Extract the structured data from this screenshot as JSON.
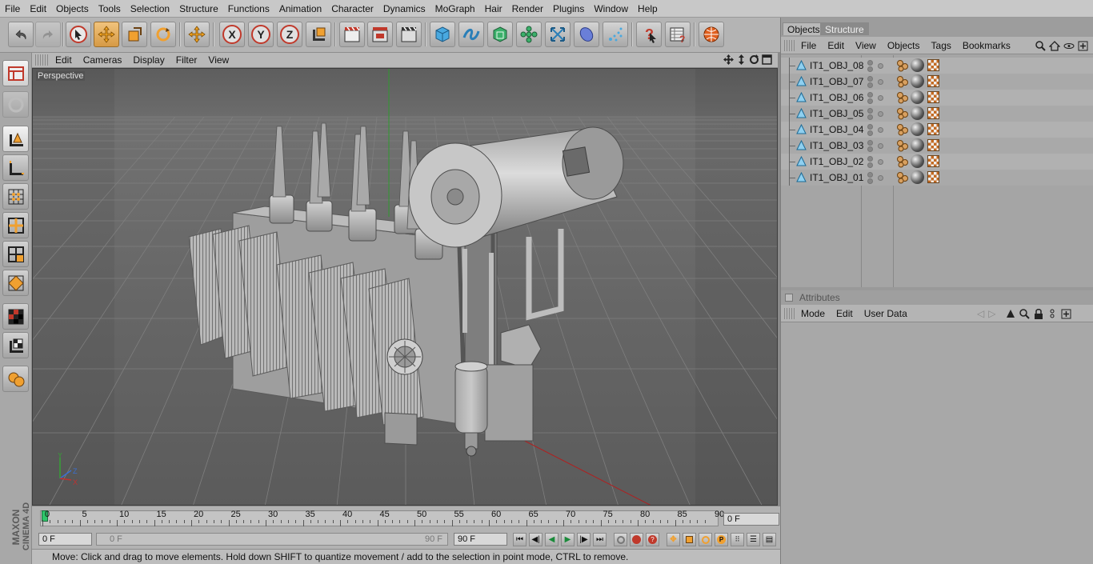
{
  "menubar": {
    "items": [
      "File",
      "Edit",
      "Objects",
      "Tools",
      "Selection",
      "Structure",
      "Functions",
      "Animation",
      "Character",
      "Dynamics",
      "MoGraph",
      "Hair",
      "Render",
      "Plugins",
      "Window",
      "Help"
    ]
  },
  "toolbar": {
    "groups": [
      "undo-icon",
      "redo-icon",
      "live-selection-icon",
      "move-icon",
      "scale-icon",
      "rotate-icon",
      "object-coords-icon",
      "x-axis-lock-icon",
      "y-axis-lock-icon",
      "z-axis-lock-icon",
      "world-coords-icon",
      "render-view-icon",
      "render-to-picture-viewer-icon",
      "render-settings-icon",
      "cube-primitive-icon",
      "spline-pen-icon",
      "subdivision-nurbs-icon",
      "array-icon",
      "deformer-icon",
      "scene-environment-icon",
      "camera-icon",
      "light-icon",
      "help-icon",
      "script-manager-icon",
      "web-browser-icon"
    ]
  },
  "viewport": {
    "menu": [
      "Edit",
      "Cameras",
      "Display",
      "Filter",
      "View"
    ],
    "label": "Perspective",
    "axis": {
      "x": "X",
      "y": "Y",
      "z": "Z"
    }
  },
  "timeline": {
    "ticks": [
      "0",
      "5",
      "10",
      "15",
      "20",
      "25",
      "30",
      "35",
      "40",
      "45",
      "50",
      "55",
      "60",
      "65",
      "70",
      "75",
      "80",
      "85",
      "90"
    ],
    "current_frame": "0 F"
  },
  "transport": {
    "start_field": "0 F",
    "range_start": "0 F",
    "range_end": "90 F",
    "end_field": "90 F"
  },
  "status": {
    "text": "Move: Click and drag to move elements. Hold down SHIFT to quantize movement / add to the selection in point mode, CTRL to remove."
  },
  "brand": {
    "line1": "MAXON",
    "line2": "CINEMA 4D"
  },
  "objects_panel": {
    "tabs": [
      "Objects",
      "Structure"
    ],
    "menu": [
      "File",
      "Edit",
      "View",
      "Objects",
      "Tags",
      "Bookmarks"
    ],
    "items": [
      {
        "name": "IT1_OBJ_08"
      },
      {
        "name": "IT1_OBJ_07"
      },
      {
        "name": "IT1_OBJ_06"
      },
      {
        "name": "IT1_OBJ_05"
      },
      {
        "name": "IT1_OBJ_04"
      },
      {
        "name": "IT1_OBJ_03"
      },
      {
        "name": "IT1_OBJ_02"
      },
      {
        "name": "IT1_OBJ_01"
      }
    ]
  },
  "attributes_panel": {
    "title": "Attributes",
    "menu": [
      "Mode",
      "Edit",
      "User Data"
    ]
  },
  "colors": {
    "accent": "#f0a030",
    "highlight": "#d69a45",
    "grid": "#7e7e7e"
  }
}
